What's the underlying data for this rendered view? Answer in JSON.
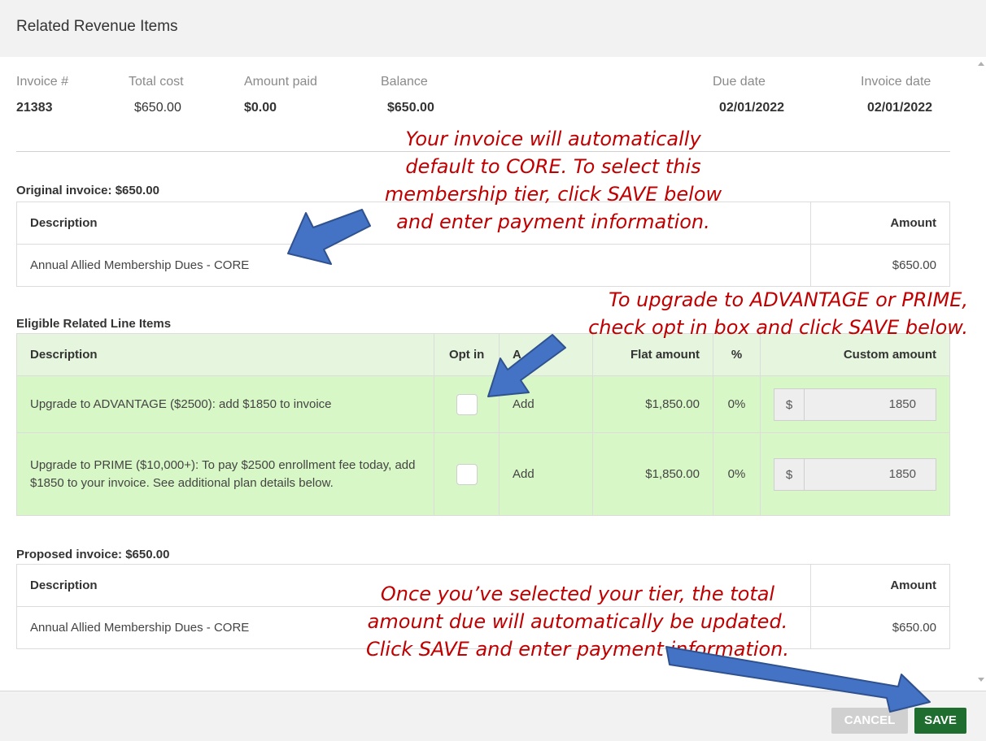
{
  "header": {
    "title": "Related Revenue Items"
  },
  "summary": {
    "invoice_number": {
      "label": "Invoice #",
      "value": "21383"
    },
    "total_cost": {
      "label": "Total cost",
      "value": "$650.00"
    },
    "amount_paid": {
      "label": "Amount paid",
      "value": "$0.00"
    },
    "balance": {
      "label": "Balance",
      "value": "$650.00"
    },
    "due_date": {
      "label": "Due date",
      "value": "02/01/2022"
    },
    "invoice_date": {
      "label": "Invoice date",
      "value": "02/01/2022"
    }
  },
  "original_invoice": {
    "label": "Original invoice: $650.00",
    "headers": {
      "description": "Description",
      "amount": "Amount"
    },
    "rows": [
      {
        "description": "Annual Allied Membership Dues - CORE",
        "amount": "$650.00"
      }
    ]
  },
  "eligible": {
    "label": "Eligible Related Line Items",
    "headers": {
      "description": "Description",
      "opt_in": "Opt in",
      "action": "A",
      "flat_amount": "Flat amount",
      "percent": "%",
      "custom_amount": "Custom amount"
    },
    "rows": [
      {
        "description": "Upgrade to ADVANTAGE ($2500): add $1850 to invoice",
        "opt_in": false,
        "action": "Add",
        "flat_amount": "$1,850.00",
        "percent": "0%",
        "currency": "$",
        "custom_amount": "1850"
      },
      {
        "description": "Upgrade to PRIME ($10,000+): To pay $2500 enrollment fee today, add $1850 to your invoice. See additional plan details below.",
        "opt_in": false,
        "action": "Add",
        "flat_amount": "$1,850.00",
        "percent": "0%",
        "currency": "$",
        "custom_amount": "1850"
      }
    ]
  },
  "proposed_invoice": {
    "label": "Proposed invoice: $650.00",
    "headers": {
      "description": "Description",
      "amount": "Amount"
    },
    "rows": [
      {
        "description": "Annual Allied Membership Dues - CORE",
        "amount": "$650.00"
      }
    ]
  },
  "annotations": {
    "core": "Your invoice will automatically\ndefault to CORE. To select this\nmembership tier, click SAVE below\nand enter payment information.",
    "upgrade": "To upgrade to ADVANTAGE or PRIME,\ncheck opt in box and click SAVE below.",
    "save": "Once you’ve selected your tier, the total\namount due will automatically be updated.\nClick SAVE and enter payment information."
  },
  "footer": {
    "cancel_label": "CANCEL",
    "save_label": "SAVE"
  },
  "colors": {
    "annotation_red": "#c00000",
    "arrow_blue": "#4472c4",
    "eligible_row_green": "#d8f7c6",
    "eligible_header_green": "#e6f5de",
    "save_green": "#1f6e2f",
    "cancel_gray": "#d0d0d0"
  }
}
